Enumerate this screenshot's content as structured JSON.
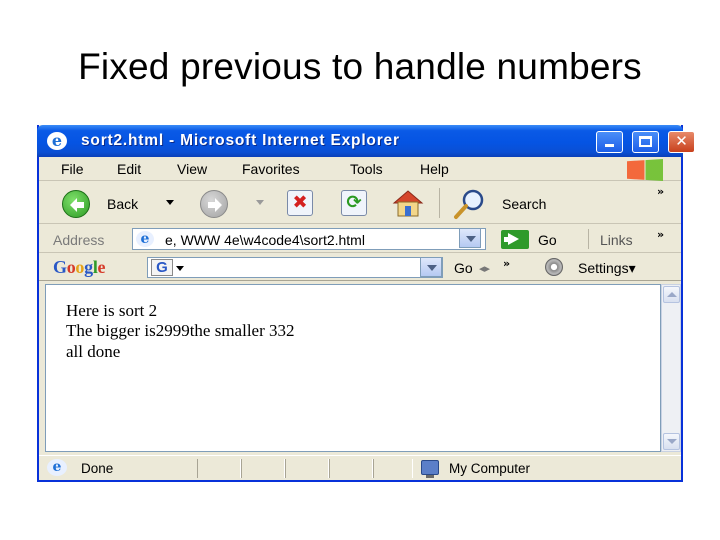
{
  "slide": {
    "title": "Fixed previous to handle numbers"
  },
  "window": {
    "title": "sort2.html - Microsoft Internet Explorer",
    "controls": {
      "minimize": "_",
      "close": "✕"
    }
  },
  "menu": [
    "File",
    "Edit",
    "View",
    "Favorites",
    "Tools",
    "Help"
  ],
  "toolbar": {
    "back_label": "Back",
    "search_label": "Search",
    "overflow": "»",
    "stop_glyph": "✖",
    "refresh_glyph": "⟳"
  },
  "address": {
    "label": "Address",
    "value": "e, WWW 4e\\w4code4\\sort2.html",
    "go_label": "Go",
    "links_label": "Links",
    "overflow": "»"
  },
  "google": {
    "logo_letters": [
      "G",
      "o",
      "o",
      "g",
      "l",
      "e"
    ],
    "logo_colors": [
      "#2a58c6",
      "#d63b2a",
      "#e6a31a",
      "#2a58c6",
      "#2f9a2a",
      "#d63b2a"
    ],
    "badge": "G",
    "go_label": "Go",
    "nav_arrows": "◂▸",
    "overflow": "»",
    "settings_label": "Settings▾"
  },
  "page": {
    "lines": [
      "Here is sort 2",
      "The bigger is2999the smaller 332",
      "all done"
    ]
  },
  "status": {
    "left_text": "Done",
    "zone_text": "My Computer"
  },
  "colors": {
    "titlebar": "#0554e3",
    "chrome": "#ece9d8",
    "border": "#0831d9"
  }
}
